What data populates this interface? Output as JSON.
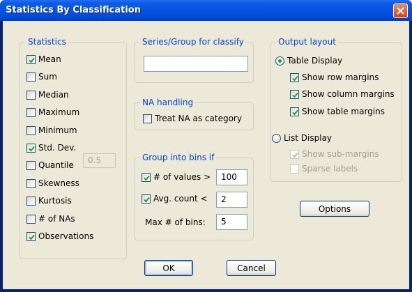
{
  "window": {
    "title": "Statistics By Classification"
  },
  "statistics": {
    "title": "Statistics",
    "items": [
      {
        "label": "Mean",
        "checked": true
      },
      {
        "label": "Sum",
        "checked": false
      },
      {
        "label": "Median",
        "checked": false
      },
      {
        "label": "Maximum",
        "checked": false
      },
      {
        "label": "Minimum",
        "checked": false
      },
      {
        "label": "Std. Dev.",
        "checked": true
      },
      {
        "label": "Quantile",
        "checked": false
      },
      {
        "label": "Skewness",
        "checked": false
      },
      {
        "label": "Kurtosis",
        "checked": false
      },
      {
        "label": "# of NAs",
        "checked": false
      },
      {
        "label": "Observations",
        "checked": true
      }
    ],
    "quantile_value": "0.5"
  },
  "series": {
    "title": "Series/Group for classify",
    "value": ""
  },
  "na": {
    "title": "NA handling",
    "treat_label": "Treat NA as category",
    "checked": false
  },
  "bins": {
    "title": "Group into bins if",
    "values_label": "# of values >",
    "values_checked": true,
    "values_value": "100",
    "avg_label": "Avg. count <",
    "avg_checked": true,
    "avg_value": "2",
    "max_label": "Max # of bins:",
    "max_value": "5"
  },
  "output": {
    "title": "Output layout",
    "table_label": "Table Display",
    "table_selected": true,
    "row_margins": "Show row margins",
    "column_margins": "Show column margins",
    "table_margins": "Show table margins",
    "list_label": "List Display",
    "list_selected": false,
    "sub_margins": "Show sub-margins",
    "sparse": "Sparse labels"
  },
  "buttons": {
    "options": "Options",
    "ok": "OK",
    "cancel": "Cancel"
  }
}
